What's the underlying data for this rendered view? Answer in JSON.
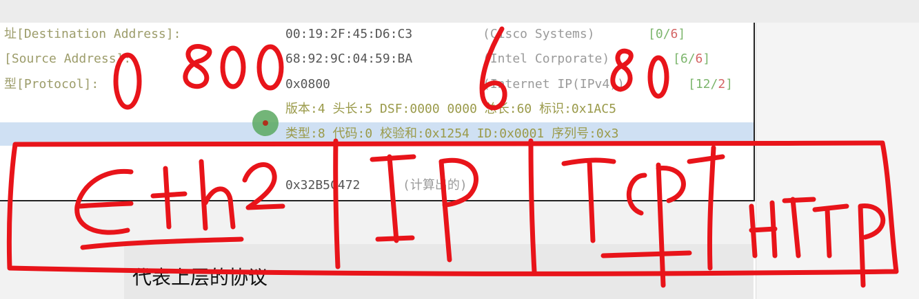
{
  "rows": [
    {
      "field": "址[Destination Address]:",
      "value": "00:19:2F:45:D6:C3",
      "vendor": "(Cisco Systems)",
      "off_a": "0",
      "off_b": "6"
    },
    {
      "field": "[Source Address]:",
      "value": "68:92:9C:04:59:BA",
      "vendor": "(Intel Corporate)",
      "off_a": "6",
      "off_b": "6"
    },
    {
      "field": "型[Protocol]:",
      "value": "0x0800",
      "vendor": "(Internet IP(IPv4))",
      "off_a": "12",
      "off_b": "2"
    }
  ],
  "ip_summary": "版本:4 头长:5 DSF:0000 0000 总长:60 标识:0x1AC5",
  "icmp_summary": "类型:8 代码:0 校验和:0x1254 ID:0x0001 序列号:0x3",
  "fcs": {
    "value": "0x32B5C472",
    "note": "(计算出的)"
  },
  "caption": "代表上层的协议",
  "annotations": {
    "handwritten": [
      "0 800",
      "6",
      "80",
      "Eth2",
      "IP",
      "TCP",
      "HTTP"
    ],
    "ink_color": "#e8141a"
  }
}
